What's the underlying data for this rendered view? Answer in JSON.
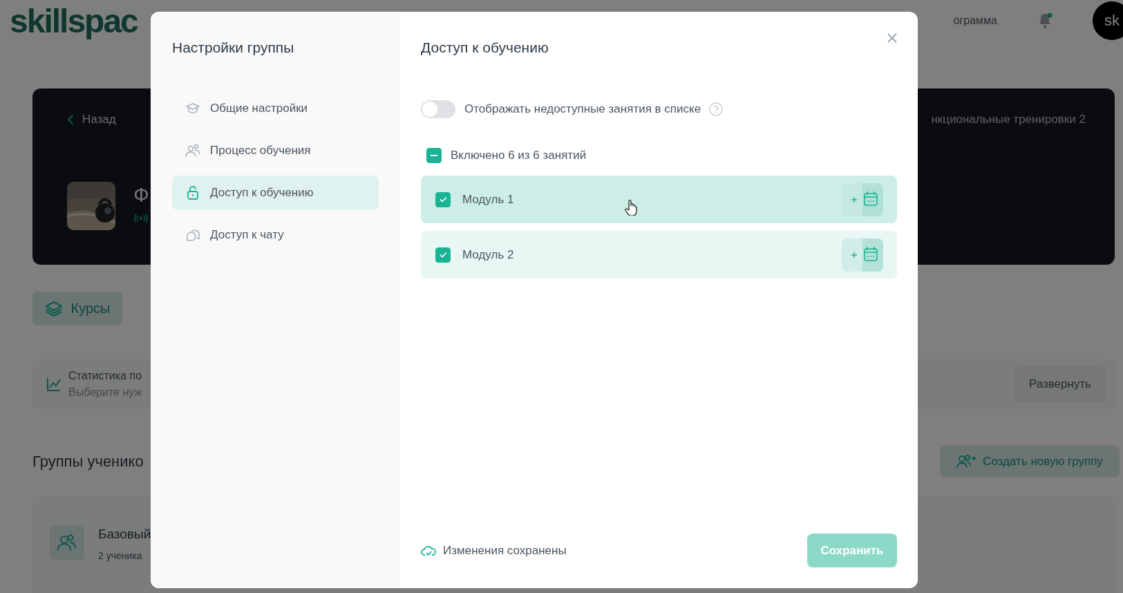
{
  "header": {
    "logo": "skillspac",
    "menu_fragment": "ограмма",
    "avatar": "sk"
  },
  "hero": {
    "back": "Назад",
    "title_fragment": "Ф",
    "course_fragment": "нкциональные тренировки 2"
  },
  "tabs": [
    {
      "label": "Курсы",
      "selected": true
    }
  ],
  "stats": {
    "title": "Статистика по",
    "subtitle": "Выберите нуж",
    "expand_button": "Развернуть"
  },
  "groups": {
    "heading": "Группы ученико",
    "create_button": "Создать новую группу",
    "cards": [
      {
        "name": "Базовый",
        "count": "2 ученика"
      }
    ]
  },
  "modal": {
    "sidebar_title": "Настройки группы",
    "nav": [
      {
        "label": "Общие настройки",
        "kind": "general",
        "selected": false
      },
      {
        "label": "Процесс обучения",
        "kind": "process",
        "selected": false
      },
      {
        "label": "Доступ к обучению",
        "kind": "access",
        "selected": true
      },
      {
        "label": "Доступ к чату",
        "kind": "chat",
        "selected": false
      }
    ],
    "title": "Доступ к обучению",
    "toggle": {
      "label": "Отображать недоступные занятия в списке",
      "on": false
    },
    "summary": {
      "label": "Включено 6 из 6 занятий",
      "indeterminate": true
    },
    "modules": [
      {
        "name": "Модуль 1",
        "checked": true,
        "hovered": true
      },
      {
        "name": "Модуль 2",
        "checked": true,
        "hovered": false
      }
    ],
    "status": "Изменения сохранены",
    "save_button": {
      "label": "Сохранить",
      "disabled": true
    }
  }
}
